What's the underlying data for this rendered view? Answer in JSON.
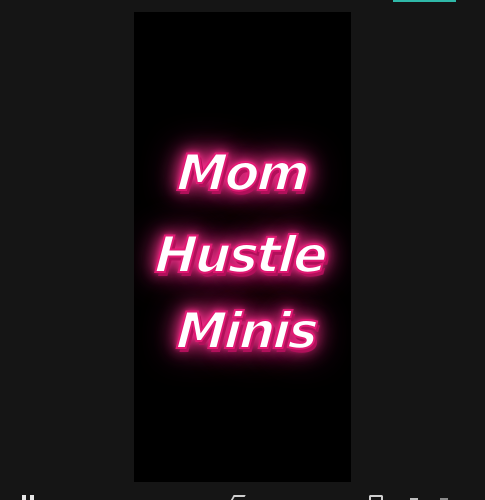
{
  "canvas": {
    "title_lines": [
      "Mom",
      "Hustle",
      "Minis"
    ]
  },
  "colors": {
    "app_background": "#151515",
    "canvas_background": "#000000",
    "text_fill": "#ffffff",
    "text_glow": "#ff2f8f",
    "accent_tab": "#2fb8a8"
  },
  "toolbar": {
    "icons": [
      "pause-icon",
      "volume-icon",
      "copy-icon",
      "back-icon",
      "forward-icon"
    ]
  }
}
